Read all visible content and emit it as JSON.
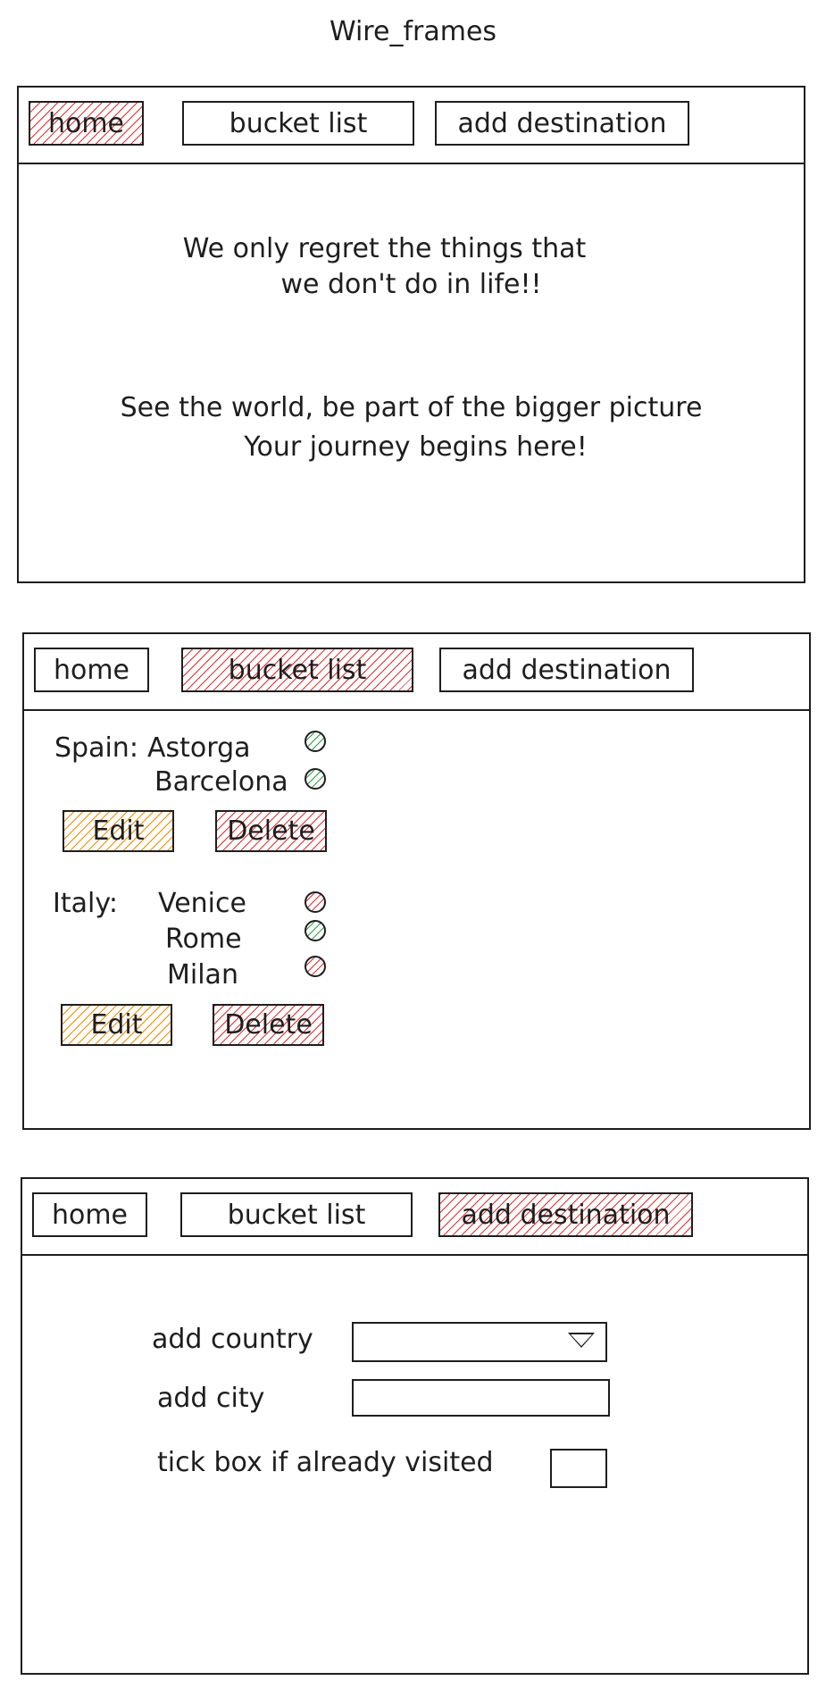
{
  "title": "Wire_frames",
  "nav": {
    "home": "home",
    "bucket_list": "bucket list",
    "add_destination": "add destination"
  },
  "home_page": {
    "quote_line1": "We only regret the things that",
    "quote_line2": "we don't do in life!!",
    "tagline_line1": "See the world, be part of the bigger picture",
    "tagline_line2": "Your journey begins here!"
  },
  "bucket_page": {
    "groups": [
      {
        "country": "Spain:",
        "cities": [
          {
            "name": "Astorga",
            "status": "visited"
          },
          {
            "name": "Barcelona",
            "status": "visited"
          }
        ]
      },
      {
        "country": "Italy:",
        "cities": [
          {
            "name": "Venice",
            "status": "not-visited"
          },
          {
            "name": "Rome",
            "status": "visited"
          },
          {
            "name": "Milan",
            "status": "not-visited"
          }
        ]
      }
    ],
    "edit_label": "Edit",
    "delete_label": "Delete"
  },
  "add_page": {
    "country_label": "add country",
    "city_label": "add city",
    "visited_label": "tick box if already visited",
    "country_value": "",
    "city_value": ""
  },
  "colors": {
    "active_tab": "#e03131",
    "edit": "#f08c00",
    "visited": "#2f9e44",
    "not_visited": "#e03131"
  }
}
